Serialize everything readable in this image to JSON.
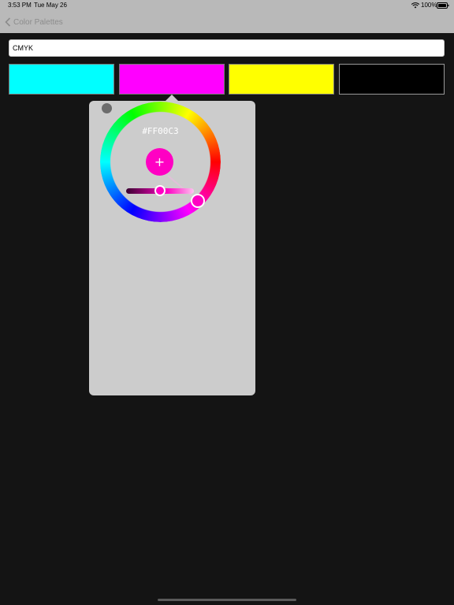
{
  "status_bar": {
    "time": "3:53 PM",
    "date": "Tue May 26",
    "battery": "100%",
    "wifi_icon": "wifi-icon",
    "battery_icon": "battery-full-icon"
  },
  "nav": {
    "back_label": "Color Palettes",
    "back_icon": "chevron-left-icon"
  },
  "palette": {
    "name": "CMYK",
    "swatches": [
      {
        "color": "#00ffff"
      },
      {
        "color": "#ff00ff"
      },
      {
        "color": "#ffff00"
      },
      {
        "color": "#000000"
      }
    ]
  },
  "picker": {
    "hex": "#FF00C3",
    "selected_color": "#ff00c3",
    "add_label": "+",
    "brightness": 0.5
  },
  "colors": {
    "background": "#141414",
    "header": "#b9b9b9",
    "popover": "#cccccc"
  }
}
